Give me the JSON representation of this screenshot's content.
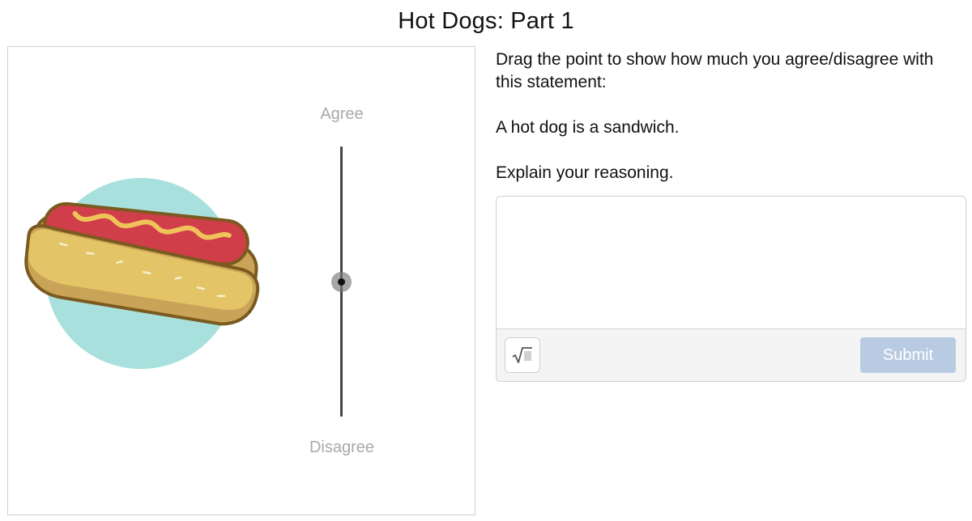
{
  "page": {
    "title": "Hot Dogs: Part 1"
  },
  "graph": {
    "top_label": "Agree",
    "bottom_label": "Disagree",
    "slider_value": 0.5,
    "illustration": "hot-dog-icon",
    "colors": {
      "circle": "#a8e0dd",
      "bun": "#e3c466",
      "bun_shadow": "#c9a458",
      "sausage": "#cf3e49",
      "mustard": "#efc25a",
      "outline": "#7b5a1f"
    }
  },
  "instructions": {
    "prompt": "Drag the point to show how much you agree/disagree with this statement:",
    "statement": "A hot dog is a sandwich.",
    "follow_up": "Explain your reasoning."
  },
  "response": {
    "value": "",
    "placeholder": "",
    "math_button_icon": "square-root-icon",
    "submit_label": "Submit",
    "submit_color": "#b9cbe2"
  }
}
